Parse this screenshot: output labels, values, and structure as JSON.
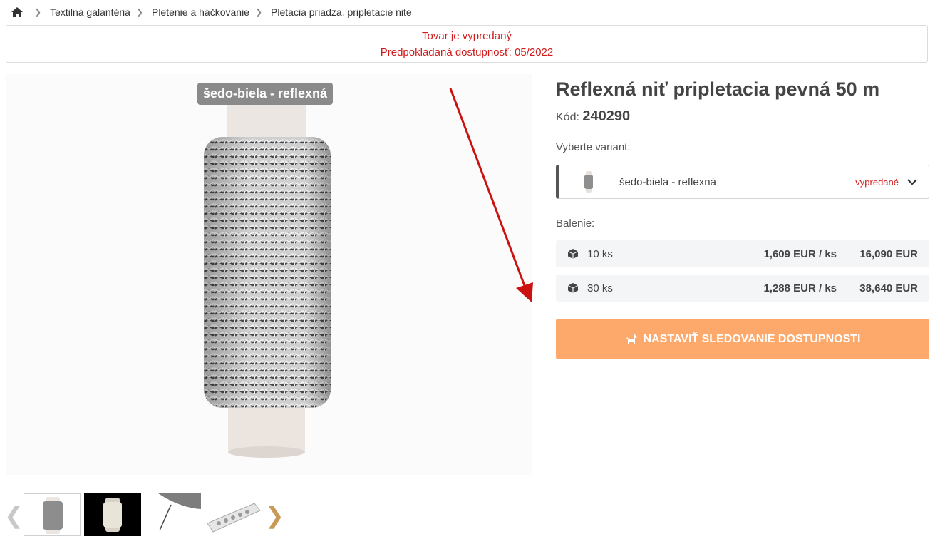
{
  "breadcrumb": {
    "home_icon": "home-icon",
    "items": [
      "Textilná galantéria",
      "Pletenie a háčkovanie",
      "Pletacia priadza, pripletacie nite"
    ]
  },
  "notice": {
    "line1": "Tovar je vypredaný",
    "line2": "Predpokladaná dostupnosť: 05/2022"
  },
  "gallery": {
    "variant_tag": "šedo-biela - reflexná",
    "thumbnails_count": 4,
    "prev_icon": "chevron-left-icon",
    "next_icon": "chevron-right-icon"
  },
  "product": {
    "title": "Reflexná niť pripletacia pevná 50 m",
    "code_label": "Kód:",
    "code_value": "240290",
    "variant_label": "Vyberte variant:",
    "selected_variant": "šedo-biela - reflexná",
    "variant_status": "vypredané",
    "packaging_label": "Balenie:",
    "packages": [
      {
        "qty": "10 ks",
        "unit_price": "1,609 EUR / ks",
        "total": "16,090 EUR"
      },
      {
        "qty": "30 ks",
        "unit_price": "1,288 EUR / ks",
        "total": "38,640 EUR"
      }
    ],
    "watch_button": "NASTAVIŤ SLEDOVANIE DOSTUPNOSTI"
  },
  "colors": {
    "accent": "#fea96c",
    "sold_out": "#d21b1b",
    "arrow": "#cc1111"
  }
}
